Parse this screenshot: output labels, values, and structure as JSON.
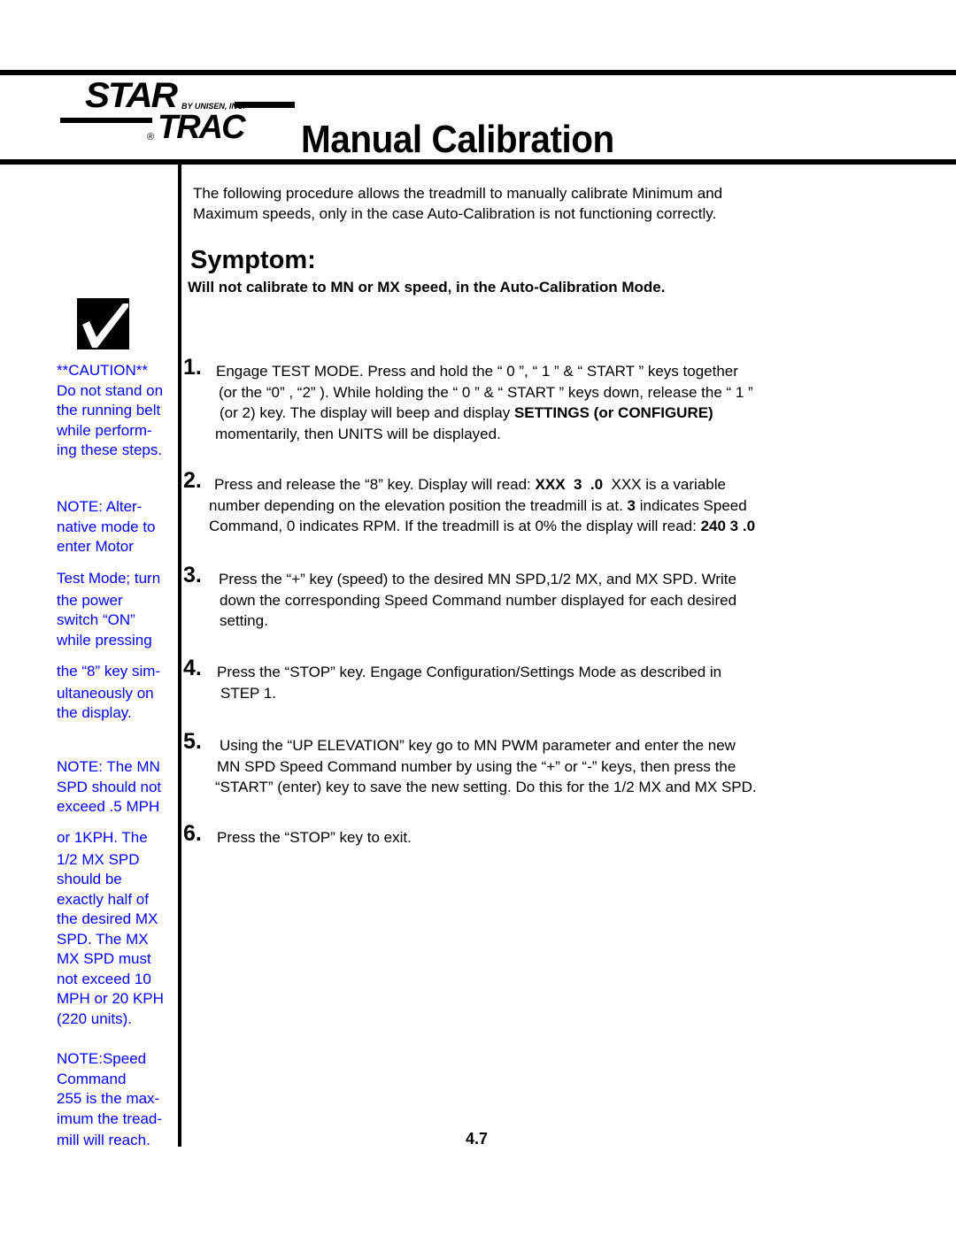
{
  "header": {
    "logo": {
      "brand_top": "STAR",
      "brand_bottom": "TRAC",
      "by_line": "BY UNISEN, INC.",
      "registered_mark": "®"
    },
    "title": "Manual Calibration"
  },
  "intro": {
    "line1": "The following procedure allows the treadmill to manually calibrate Minimum and",
    "line2": "Maximum speeds, only in the case Auto-Calibration is not functioning correctly."
  },
  "symptom": {
    "heading": "Symptom:",
    "text": "Will not calibrate to MN or MX speed, in the Auto-Calibration Mode."
  },
  "sidebar": {
    "check_icon": "checkmark-box-icon",
    "caution": [
      "**CAUTION**",
      "Do not stand on",
      "the running belt",
      "while perform-",
      "ing these steps."
    ],
    "note_alt_mode_a": [
      "NOTE: Alter-",
      "native mode to",
      "enter Motor"
    ],
    "note_alt_mode_b": [
      "Test Mode; turn",
      "the power",
      "switch “ON”",
      "while pressing"
    ],
    "note_alt_mode_c": [
      "the “8” key sim-",
      "ultaneously on",
      "the display."
    ],
    "note_mn_a": [
      "NOTE: The MN",
      "SPD should not",
      "exceed .5 MPH"
    ],
    "note_mn_b": [
      "or 1KPH. The",
      "1/2  MX SPD",
      "should be",
      "exactly half of",
      "the desired MX",
      "SPD. The MX",
      "MX SPD must",
      "not exceed 10",
      "MPH or 20 KPH",
      "(220 units)."
    ],
    "note_speed": [
      "NOTE:Speed",
      "Command",
      "255 is the max-",
      "imum the tread-",
      "mill will reach."
    ],
    "text_color": "#0000FF"
  },
  "steps": [
    {
      "number": "1.",
      "lines": [
        "Engage TEST MODE. Press and hold the “ 0 ”, “ 1 ”  & “ START ” keys together",
        "(or the “0” , “2” ).  While holding the “ 0 ” & “ START ” keys down, release the “ 1 ”",
        "(or 2) key. The display will beep and display ",
        "momentarily, then UNITS will be displayed."
      ],
      "bold_fragment": "SETTINGS (or CONFIGURE)"
    },
    {
      "number": "2.",
      "line1_pre": "Press and release the “8” key.   Display will read:  ",
      "line1_bold": "XXX  3  .0",
      "line1_post": "  XXX is a variable",
      "line2_pre": "number depending on the elevation position the treadmill is at. ",
      "line2_bold": "3",
      "line2_post": " indicates Speed",
      "line3_pre": "Command, 0 indicates RPM. If the treadmill is at 0% the display will read: ",
      "line3_bold": "240 3 .0"
    },
    {
      "number": "3.",
      "lines": [
        "Press the “+” key (speed) to the desired MN SPD,1/2 MX, and MX SPD. Write",
        "down the corresponding Speed Command number displayed for each desired",
        "setting."
      ]
    },
    {
      "number": "4.",
      "lines": [
        "Press the “STOP” key. Engage Configuration/Settings Mode as described in",
        "STEP 1."
      ]
    },
    {
      "number": "5.",
      "lines": [
        "Using the “UP ELEVATION” key go to MN PWM parameter and enter the new",
        "MN SPD Speed Command number by using the “+” or “-” keys, then press the",
        "“START” (enter) key to save the new setting. Do this for the 1/2 MX and MX SPD."
      ]
    },
    {
      "number": "6.",
      "lines": [
        "Press the “STOP” key to exit."
      ]
    }
  ],
  "footer": {
    "page_number": "4.7"
  }
}
